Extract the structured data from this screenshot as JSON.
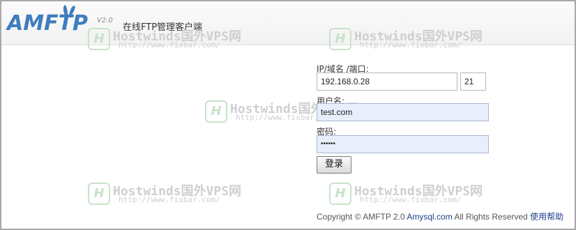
{
  "header": {
    "logo_text": "AMFTP",
    "version": "V2.0",
    "subtitle": "在线FTP管理客户端"
  },
  "watermark": {
    "logo": "H",
    "title": "Hostwinds国外VPS网",
    "url": "http://www.fixbar.com/"
  },
  "login_form": {
    "host_label": "IP/域名 /端口:",
    "host_value": "192.168.0.28",
    "port_value": "21",
    "user_label": "用户名:",
    "user_value": "test.com",
    "password_label": "密码:",
    "password_value": "••••••",
    "login_label": "登录"
  },
  "footer": {
    "copyright": "Copyright © AMFTP 2.0 ",
    "site_link": "Amysql.com",
    "rights": " All Rights Reserved ",
    "help_link": "使用帮助"
  },
  "colors": {
    "brand": "#3e7dbf",
    "input_highlight": "#e8eefb",
    "link": "#1d3f8a"
  }
}
